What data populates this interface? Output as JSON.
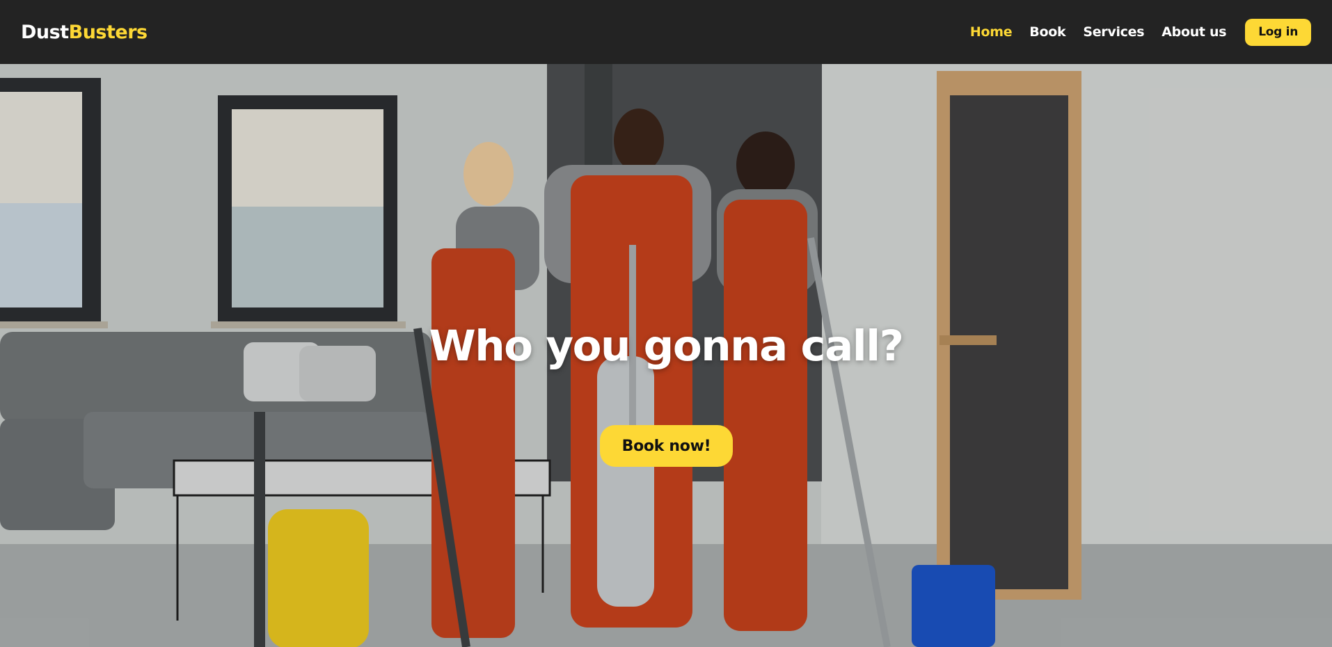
{
  "brand": {
    "part1": "Dust",
    "part2": "Busters"
  },
  "nav": {
    "items": [
      {
        "label": "Home",
        "active": true
      },
      {
        "label": "Book",
        "active": false
      },
      {
        "label": "Services",
        "active": false
      },
      {
        "label": "About us",
        "active": false
      }
    ],
    "login_label": "Log in"
  },
  "hero": {
    "title": "Who you gonna call?",
    "cta_label": "Book now!"
  },
  "colors": {
    "accent": "#fdd835",
    "navbar_bg": "#232323",
    "text_light": "#ffffff"
  }
}
